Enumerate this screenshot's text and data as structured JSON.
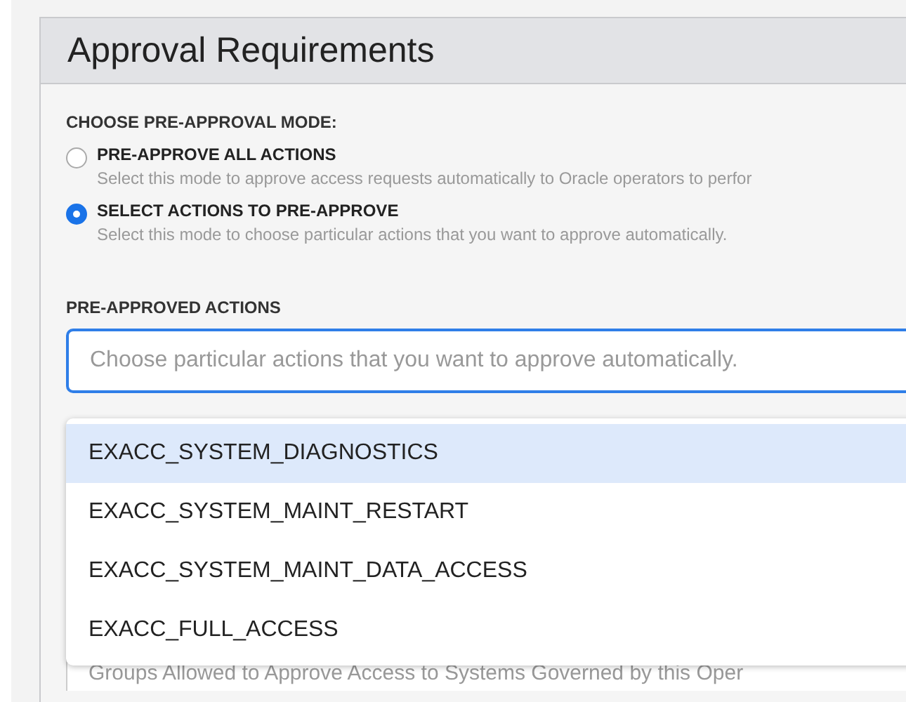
{
  "panel": {
    "title": "Approval Requirements"
  },
  "mode_label": "CHOOSE PRE-APPROVAL MODE:",
  "modes": [
    {
      "label": "PRE-APPROVE ALL ACTIONS",
      "description": "Select this mode to approve access requests automatically to Oracle operators to perfor",
      "selected": false
    },
    {
      "label": "SELECT ACTIONS TO PRE-APPROVE",
      "description": "Select this mode to choose particular actions that you want to approve automatically.",
      "selected": true
    }
  ],
  "actions_field": {
    "label": "PRE-APPROVED ACTIONS",
    "placeholder": "Choose particular actions that you want to approve automatically."
  },
  "dropdown": [
    {
      "label": "EXACC_SYSTEM_DIAGNOSTICS",
      "selected": true
    },
    {
      "label": "EXACC_SYSTEM_MAINT_RESTART",
      "selected": false
    },
    {
      "label": "EXACC_SYSTEM_MAINT_DATA_ACCESS",
      "selected": false
    },
    {
      "label": "EXACC_FULL_ACCESS",
      "selected": false
    }
  ],
  "groups_field": {
    "placeholder": "Groups Allowed to Approve Access to Systems Governed by this Oper"
  }
}
